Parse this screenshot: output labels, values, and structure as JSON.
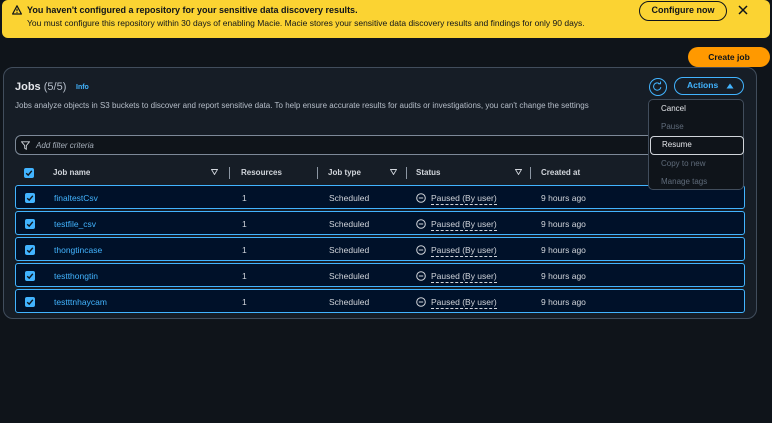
{
  "banner": {
    "title": "You haven't configured a repository for your sensitive data discovery results.",
    "subtitle": "You must configure this repository within 30 days of enabling Macie. Macie stores your sensitive data discovery results and findings for only 90 days.",
    "configure_label": "Configure now",
    "icon": "warning-icon",
    "bg_color": "#fbd332"
  },
  "create_job_label": "Create job",
  "panel": {
    "title": "Jobs",
    "count": "(5/5)",
    "info_label": "Info",
    "description": "Jobs analyze objects in S3 buckets to discover and report sensitive data. To help ensure accurate results for audits or investigations, you can't change the settings",
    "actions_label": "Actions",
    "filter_placeholder": "Add filter criteria"
  },
  "table": {
    "columns": [
      "Job name",
      "Resources",
      "Job type",
      "Status",
      "Created at"
    ],
    "rows": [
      {
        "name": "finaltestCsv",
        "resources": "1",
        "type": "Scheduled",
        "status": "Paused (By user)",
        "created": "9 hours ago"
      },
      {
        "name": "testfile_csv",
        "resources": "1",
        "type": "Scheduled",
        "status": "Paused (By user)",
        "created": "9 hours ago"
      },
      {
        "name": "thongtincase",
        "resources": "1",
        "type": "Scheduled",
        "status": "Paused (By user)",
        "created": "9 hours ago"
      },
      {
        "name": "testthongtin",
        "resources": "1",
        "type": "Scheduled",
        "status": "Paused (By user)",
        "created": "9 hours ago"
      },
      {
        "name": "testttnhaycam",
        "resources": "1",
        "type": "Scheduled",
        "status": "Paused (By user)",
        "created": "9 hours ago"
      }
    ]
  },
  "actions_menu": {
    "items": [
      {
        "label": "Cancel",
        "state": "enabled"
      },
      {
        "label": "Pause",
        "state": "disabled"
      },
      {
        "label": "Resume",
        "state": "selected"
      },
      {
        "label": "Copy to new",
        "state": "disabled"
      },
      {
        "label": "Manage tags",
        "state": "disabled"
      }
    ]
  },
  "colors": {
    "accent": "#42b4ff",
    "primary_button": "#ff9900",
    "background": "#0f141a"
  }
}
